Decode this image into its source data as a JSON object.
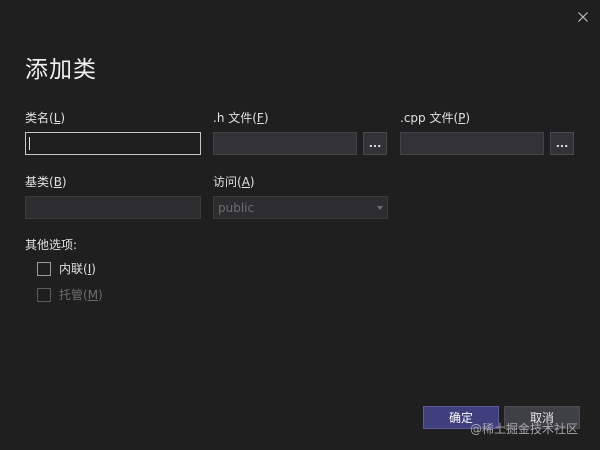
{
  "dialog": {
    "title": "添加类",
    "close_icon": "close-icon"
  },
  "fields": {
    "class_name": {
      "label": "类名(",
      "accesskey": "L",
      "label_suffix": ")",
      "value": ""
    },
    "h_file": {
      "label": ".h 文件(",
      "accesskey": "F",
      "label_suffix": ")",
      "value": "",
      "browse_label": "..."
    },
    "cpp_file": {
      "label": ".cpp 文件(",
      "accesskey": "P",
      "label_suffix": ")",
      "value": "",
      "browse_label": "..."
    },
    "base_class": {
      "label": "基类(",
      "accesskey": "B",
      "label_suffix": ")",
      "value": ""
    },
    "access": {
      "label": "访问(",
      "accesskey": "A",
      "label_suffix": ")",
      "selected": "public"
    }
  },
  "options": {
    "heading": "其他选项:",
    "inline": {
      "label": "内联(",
      "accesskey": "I",
      "label_suffix": ")",
      "checked": false
    },
    "managed": {
      "label": "托管(",
      "accesskey": "M",
      "label_suffix": ")",
      "checked": false
    }
  },
  "buttons": {
    "ok": "确定",
    "cancel": "取消"
  },
  "watermark": "@稀土掘金技术社区",
  "colors": {
    "background": "#1f1f1f",
    "primary_button": "#3f3f7e",
    "input_background": "#333337"
  }
}
